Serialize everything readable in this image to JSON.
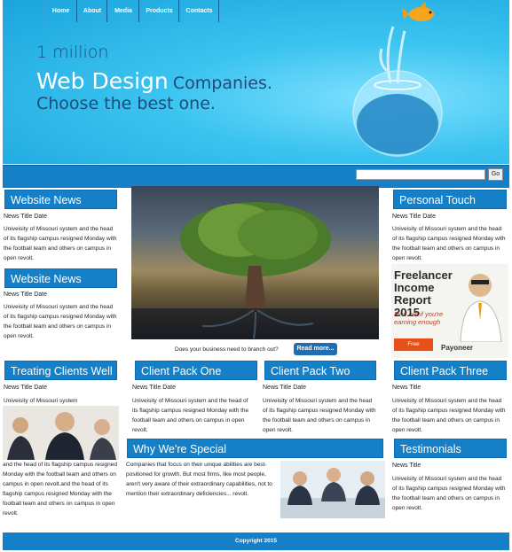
{
  "banner": {
    "line1": "1 million",
    "line2_big": "Web Design",
    "line2_small": "Companies.",
    "line3": "Choose the best one."
  },
  "nav": {
    "items": [
      "Home",
      "About",
      "Media",
      "Products",
      "Contacts"
    ],
    "search_value": "",
    "go_label": "Go"
  },
  "left": {
    "box1_title": "Website News",
    "box1_head": "News Title Date",
    "box1_text": "Univeisity of Missouri system and the head of its flagship campus resigned Monday with the football team and others on campus in open revolt.",
    "box2_title": "Website News",
    "box2_head": "News Title Date",
    "box2_text": "Univeisity of Missouri system and the head of its flagship campus resigned Monday with the football team and others on campus in open revolt."
  },
  "center": {
    "caption": "Does your business need to branch out?",
    "read_more": "Read more..."
  },
  "right": {
    "box1_title": "Personal Touch",
    "box1_head": "News Title Date",
    "box1_text": "Univeisity of Missouri system and the head of its flagship campus resigned Monday with the football team and others on campus in open revolt.",
    "ad_title": "Freelancer Income Report 2015",
    "ad_sub": "Find out if you're earning enough",
    "ad_btn": "Free Download",
    "ad_logo": "Payoneer"
  },
  "row2": {
    "col1_title": "Treating Clients Well",
    "col1_head": "News Title Date",
    "col1_intro": "Univeisity of Missouri system",
    "col1_text": "and the head of its flagship campus resigned Monday with the football team and others on campus in open revolt.and the head of its flagship campus resigned Monday with the football team and others on campus in open revolt.",
    "col2_title": "Client Pack One",
    "col2_head": "News Title Date",
    "col2_text": "Univeisity of Missouri system and the head of its flagship campus resigned Monday with the football team and others on campus in open revolt.",
    "col3_title": "Client Pack Two",
    "col3_head": "News Title Date",
    "col3_text": "Univeisity of Missouri system and the head of its flagship campus resigned Monday with the football team and others on campus in open revolt.",
    "col4_title": "Client Pack Three",
    "col4_head": "News Title",
    "col4_text": "Univeisity of Missouri system and the head of its flagship campus resigned Monday with the football team and others on campus in open revolt."
  },
  "special": {
    "title": "Why We're Special",
    "text": "Companies that focus on their unique abilities are best-positioned for growth. But most firms, like most people, aren't very aware of their extraordinary capabilities, not to mention their extraordinary deficiencies... revolt."
  },
  "testimonials": {
    "title": "Testimonials",
    "head": "News Title",
    "text": "Univeisity of Missouri system and the head of its flagship campus resigned Monday with the football team and others on campus in open revolt."
  },
  "footer": {
    "text": "Copyright 2015"
  }
}
